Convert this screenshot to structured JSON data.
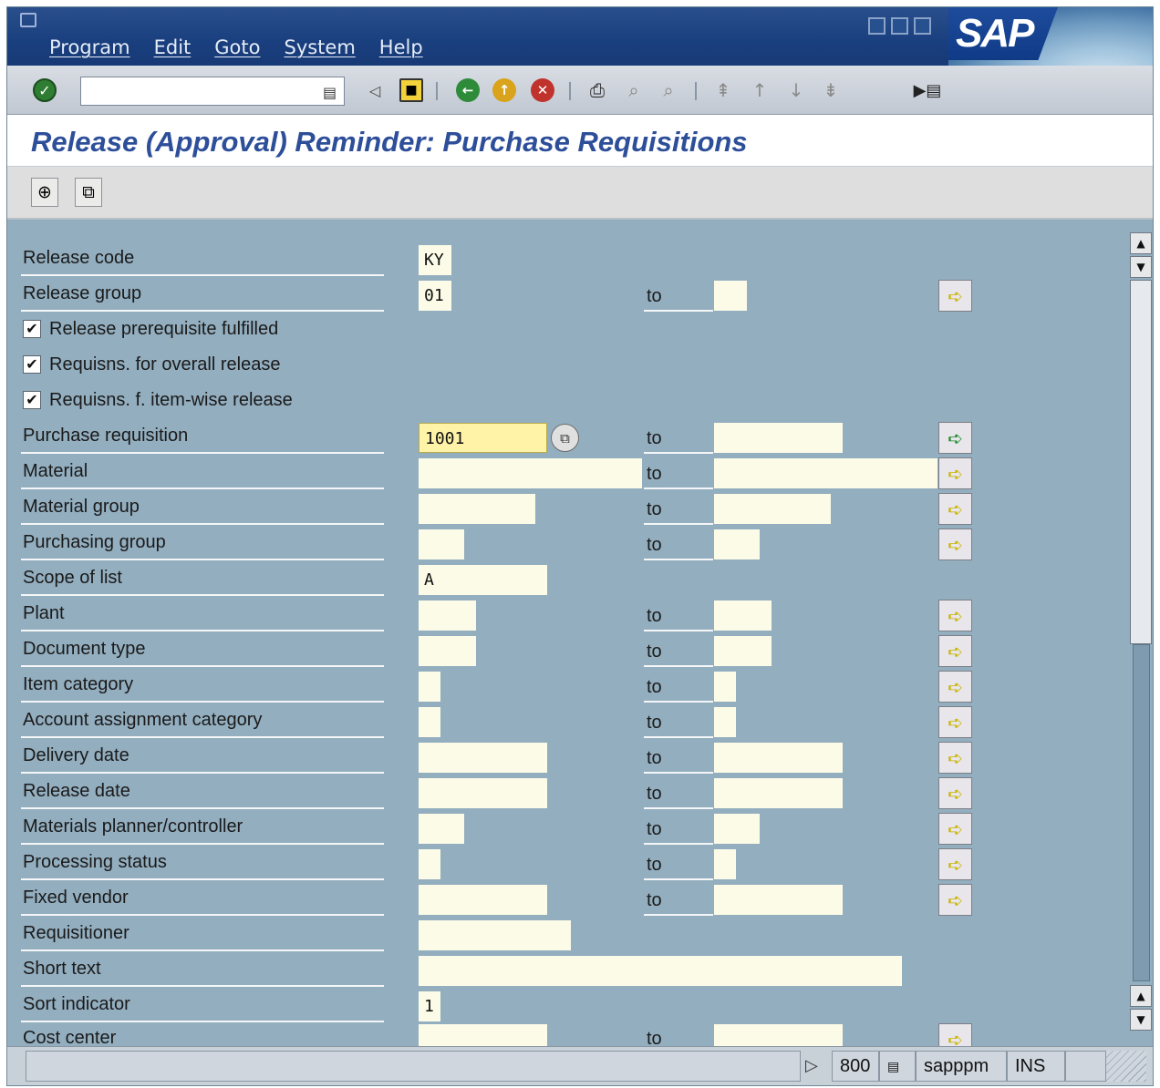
{
  "menu": [
    "Program",
    "Edit",
    "Goto",
    "System",
    "Help"
  ],
  "logo_text": "SAP",
  "toolbar": {
    "command_value": "",
    "icons": [
      "enter-icon",
      "save-icon",
      "back-icon",
      "exit-icon",
      "cancel-icon",
      "print-icon",
      "find-icon",
      "find-next-icon",
      "first-page-icon",
      "previous-page-icon",
      "next-page-icon",
      "last-page-icon",
      "customize-layout-icon"
    ]
  },
  "page_title": "Release (Approval) Reminder: Purchase Requisitions",
  "app_toolbar": [
    "execute-icon",
    "get-variant-icon"
  ],
  "fields": {
    "release_code": {
      "label": "Release code",
      "value": "KY"
    },
    "release_group": {
      "label": "Release group",
      "from": "01",
      "to": ""
    },
    "chk_prereq": {
      "label": "Release prerequisite fulfilled",
      "checked": true
    },
    "chk_overall": {
      "label": "Requisns. for overall release",
      "checked": true
    },
    "chk_itemwise": {
      "label": "Requisns. f. item-wise release",
      "checked": true
    },
    "purchase_req": {
      "label": "Purchase requisition",
      "from": "1001",
      "to": ""
    },
    "material": {
      "label": "Material",
      "from": "",
      "to": ""
    },
    "material_group": {
      "label": "Material group",
      "from": "",
      "to": ""
    },
    "purchasing_group": {
      "label": "Purchasing group",
      "from": "",
      "to": ""
    },
    "scope_of_list": {
      "label": "Scope of list",
      "value": "A"
    },
    "plant": {
      "label": "Plant",
      "from": "",
      "to": ""
    },
    "document_type": {
      "label": "Document type",
      "from": "",
      "to": ""
    },
    "item_category": {
      "label": "Item category",
      "from": "",
      "to": ""
    },
    "account_assignment": {
      "label": "Account assignment category",
      "from": "",
      "to": ""
    },
    "delivery_date": {
      "label": "Delivery date",
      "from": "",
      "to": ""
    },
    "release_date": {
      "label": "Release date",
      "from": "",
      "to": ""
    },
    "mat_planner": {
      "label": "Materials planner/controller",
      "from": "",
      "to": ""
    },
    "processing_status": {
      "label": "Processing status",
      "from": "",
      "to": ""
    },
    "fixed_vendor": {
      "label": "Fixed vendor",
      "from": "",
      "to": ""
    },
    "requisitioner": {
      "label": "Requisitioner",
      "value": ""
    },
    "short_text": {
      "label": "Short text",
      "value": ""
    },
    "sort_indicator": {
      "label": "Sort indicator",
      "value": "1"
    },
    "cost_center": {
      "label": "Cost center",
      "from": "",
      "to": ""
    }
  },
  "to_label": "to",
  "statusbar": {
    "client": "800",
    "server": "sapppm",
    "mode": "INS"
  }
}
